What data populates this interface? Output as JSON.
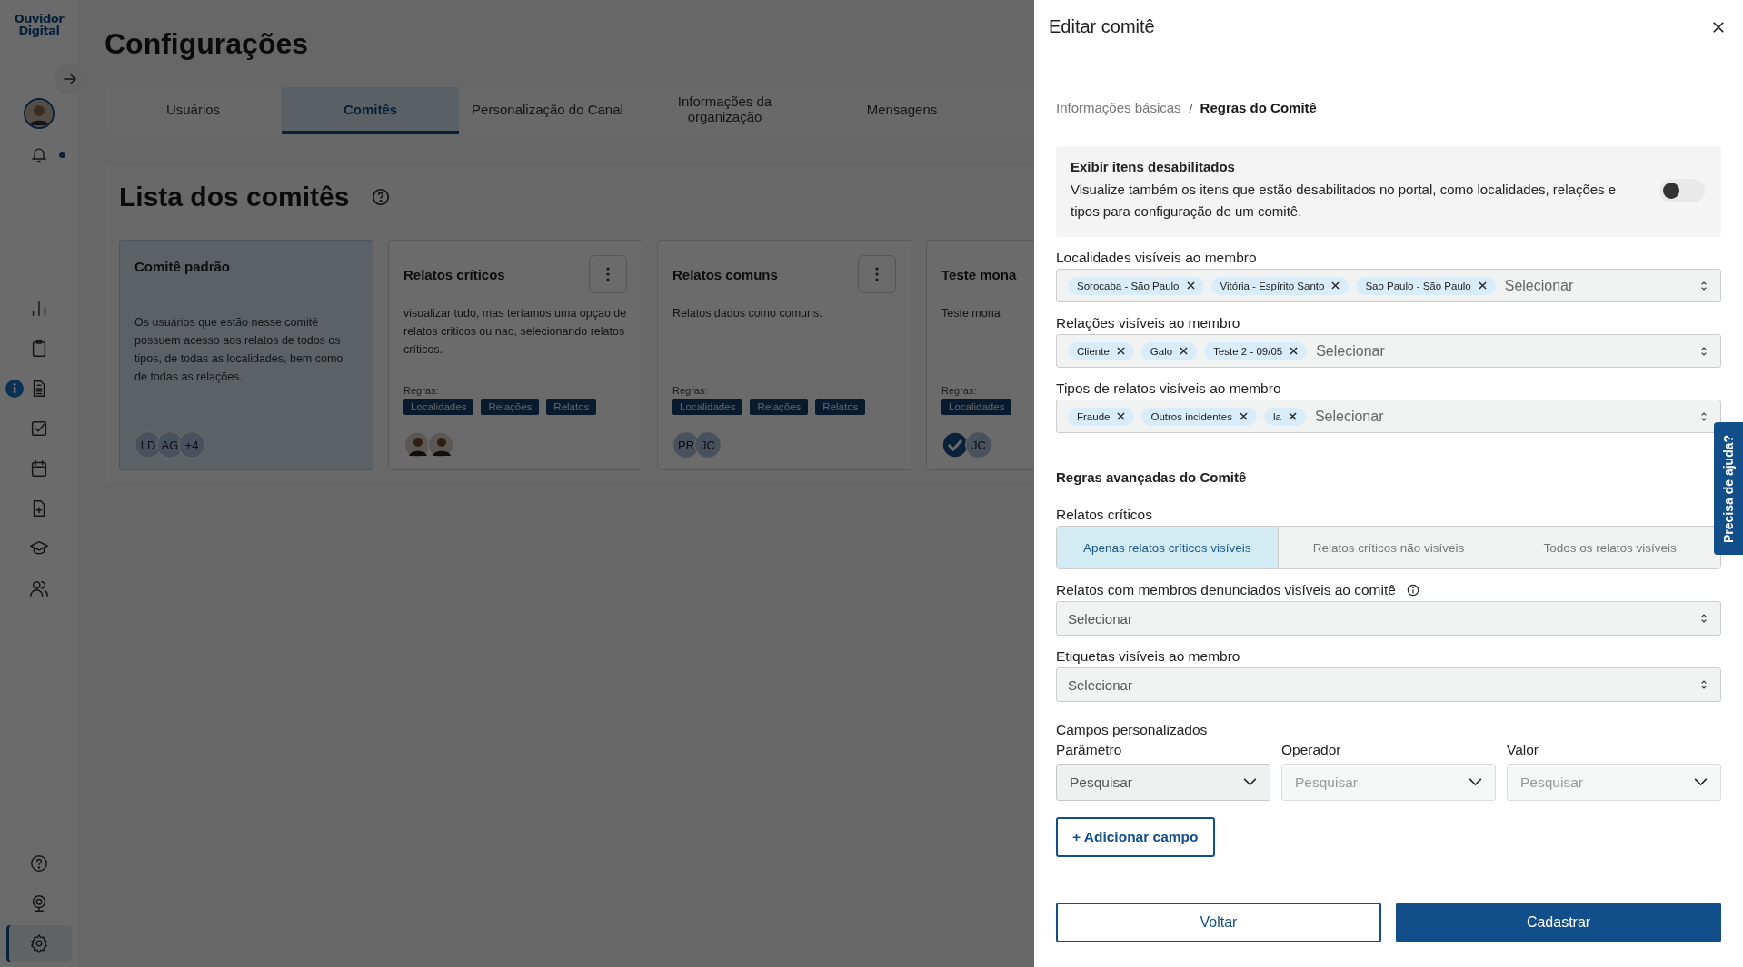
{
  "sidebar": {
    "logo": {
      "line1": "Ouvidor",
      "line2": "Digital"
    },
    "notification_unread": true,
    "info_badge": true,
    "items": [
      {
        "selected": false
      },
      {
        "selected": false
      },
      {
        "selected": false
      },
      {
        "selected": false
      },
      {
        "selected": false
      },
      {
        "selected": false
      },
      {
        "selected": false
      },
      {
        "selected": false
      }
    ],
    "bottom_items": [
      {
        "selected": false
      },
      {
        "selected": false
      },
      {
        "selected": true
      }
    ]
  },
  "page": {
    "title": "Configurações",
    "tabs": [
      {
        "label": "Usuários",
        "selected": false
      },
      {
        "label": "Comitês",
        "selected": true
      },
      {
        "label": "Personalização do Canal",
        "selected": false
      },
      {
        "label": "Informações da organização",
        "selected": false
      },
      {
        "label": "Mensagens",
        "selected": false
      }
    ],
    "section_title": "Lista dos comitês",
    "cards": [
      {
        "title": "Comitê padrão",
        "selected": true,
        "has_menu": false,
        "description": "Os usuários que estão nesse comitê possuem acesso aos relatos de todos os tipos, de todas as localidades, bem como de todas as relações.",
        "members": [
          {
            "kind": "initials",
            "text": "LD"
          },
          {
            "kind": "initials",
            "text": "AG"
          },
          {
            "kind": "initials",
            "text": "+4"
          }
        ]
      },
      {
        "title": "Relatos críticos",
        "selected": false,
        "has_menu": true,
        "description": "visualizar tudo, mas teríamos uma opçao de relatos criticos ou nao, selecionando relatos críticos.",
        "rules_label": "Regras:",
        "rules": [
          "Localidades",
          "Relações",
          "Relatos"
        ],
        "members": [
          {
            "kind": "photo"
          },
          {
            "kind": "photo"
          }
        ]
      },
      {
        "title": "Relatos comuns",
        "selected": false,
        "has_menu": true,
        "description": "Relatos dados como comuns.",
        "rules_label": "Regras:",
        "rules": [
          "Localidades",
          "Relações",
          "Relatos"
        ],
        "members": [
          {
            "kind": "initials",
            "text": "PR"
          },
          {
            "kind": "initials",
            "text": "JC"
          }
        ]
      },
      {
        "title": "Teste mona",
        "selected": false,
        "has_menu": false,
        "description": "Teste mona",
        "rules_label": "Regras:",
        "rules": [
          "Localidades"
        ],
        "members": [
          {
            "kind": "logo"
          },
          {
            "kind": "initials",
            "text": "JC"
          }
        ]
      }
    ]
  },
  "drawer": {
    "title": "Editar comitê",
    "breadcrumb": [
      {
        "label": "Informações básicas",
        "current": false
      },
      {
        "label": "Regras do Comitê",
        "current": true
      }
    ],
    "toggle": {
      "title": "Exibir itens desabilitados",
      "description": "Visualize também os itens que estão desabilitados no portal, como localidades, relações e tipos para configuração de um comitê.",
      "on": false
    },
    "multi_selects": [
      {
        "label": "Localidades visíveis ao membro",
        "chips": [
          "Sorocaba - São Paulo",
          "Vitória - Espírito Santo",
          "Sao Paulo - São Paulo"
        ],
        "placeholder": "Selecionar"
      },
      {
        "label": "Relações visíveis ao membro",
        "chips": [
          "Cliente",
          "Galo",
          "Teste 2 - 09/05"
        ],
        "placeholder": "Selecionar"
      },
      {
        "label": "Tipos de relatos visíveis ao membro",
        "chips": [
          "Fraude",
          "Outros incidentes",
          "la"
        ],
        "placeholder": "Selecionar"
      }
    ],
    "advanced_title": "Regras avançadas do Comitê",
    "critical": {
      "label": "Relatos críticos",
      "options": [
        {
          "label": "Apenas relatos críticos visíveis",
          "selected": true
        },
        {
          "label": "Relatos críticos não visíveis",
          "selected": false
        },
        {
          "label": "Todos os relatos visíveis",
          "selected": false
        }
      ]
    },
    "selects": [
      {
        "label": "Relatos com membros denunciados visíveis ao comitê",
        "info": true,
        "placeholder": "Selecionar"
      },
      {
        "label": "Etiquetas visíveis ao membro",
        "info": false,
        "placeholder": "Selecionar"
      }
    ],
    "custom_fields": {
      "label": "Campos personalizados",
      "columns": [
        {
          "label": "Parâmetro",
          "placeholder": "Pesquisar",
          "disabled": false
        },
        {
          "label": "Operador",
          "placeholder": "Pesquisar",
          "disabled": true
        },
        {
          "label": "Valor",
          "placeholder": "Pesquisar",
          "disabled": true
        }
      ],
      "add_button": "+ Adicionar campo"
    },
    "buttons": {
      "back": "Voltar",
      "submit": "Cadastrar"
    }
  },
  "help_tab": "Precisa de ajuda?"
}
